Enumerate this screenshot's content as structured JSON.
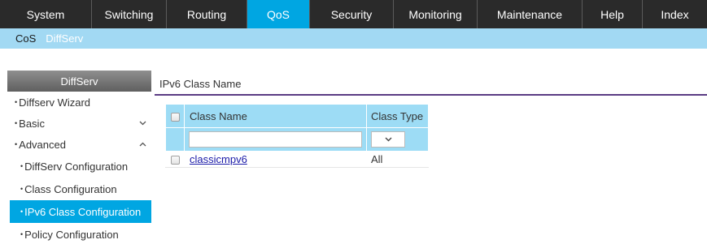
{
  "topnav": {
    "tabs": [
      {
        "label": "System"
      },
      {
        "label": "Switching"
      },
      {
        "label": "Routing"
      },
      {
        "label": "QoS",
        "active": true
      },
      {
        "label": "Security"
      },
      {
        "label": "Monitoring"
      },
      {
        "label": "Maintenance"
      },
      {
        "label": "Help"
      },
      {
        "label": "Index"
      }
    ],
    "active_color": "#00a6e2"
  },
  "subnav": {
    "items": [
      {
        "label": "CoS"
      },
      {
        "label": "DiffServ"
      }
    ]
  },
  "sidebar": {
    "header": "DiffServ",
    "items": [
      {
        "label": "Diffserv Wizard"
      },
      {
        "label": "Basic",
        "chevron": "chevron-down-icon"
      },
      {
        "label": "Advanced",
        "chevron": "chevron-up-icon"
      },
      {
        "label": "DiffServ Configuration"
      },
      {
        "label": "Class Configuration"
      },
      {
        "label": "IPv6 Class Configuration",
        "active": true
      },
      {
        "label": "Policy Configuration"
      }
    ]
  },
  "main": {
    "title": "IPv6 Class Name",
    "table": {
      "columns": [
        "Class Name",
        "Class Type"
      ],
      "filter": {
        "name_value": "",
        "type_value": ""
      },
      "rows": [
        {
          "name": "classicmpv6",
          "type": "All"
        }
      ]
    }
  }
}
